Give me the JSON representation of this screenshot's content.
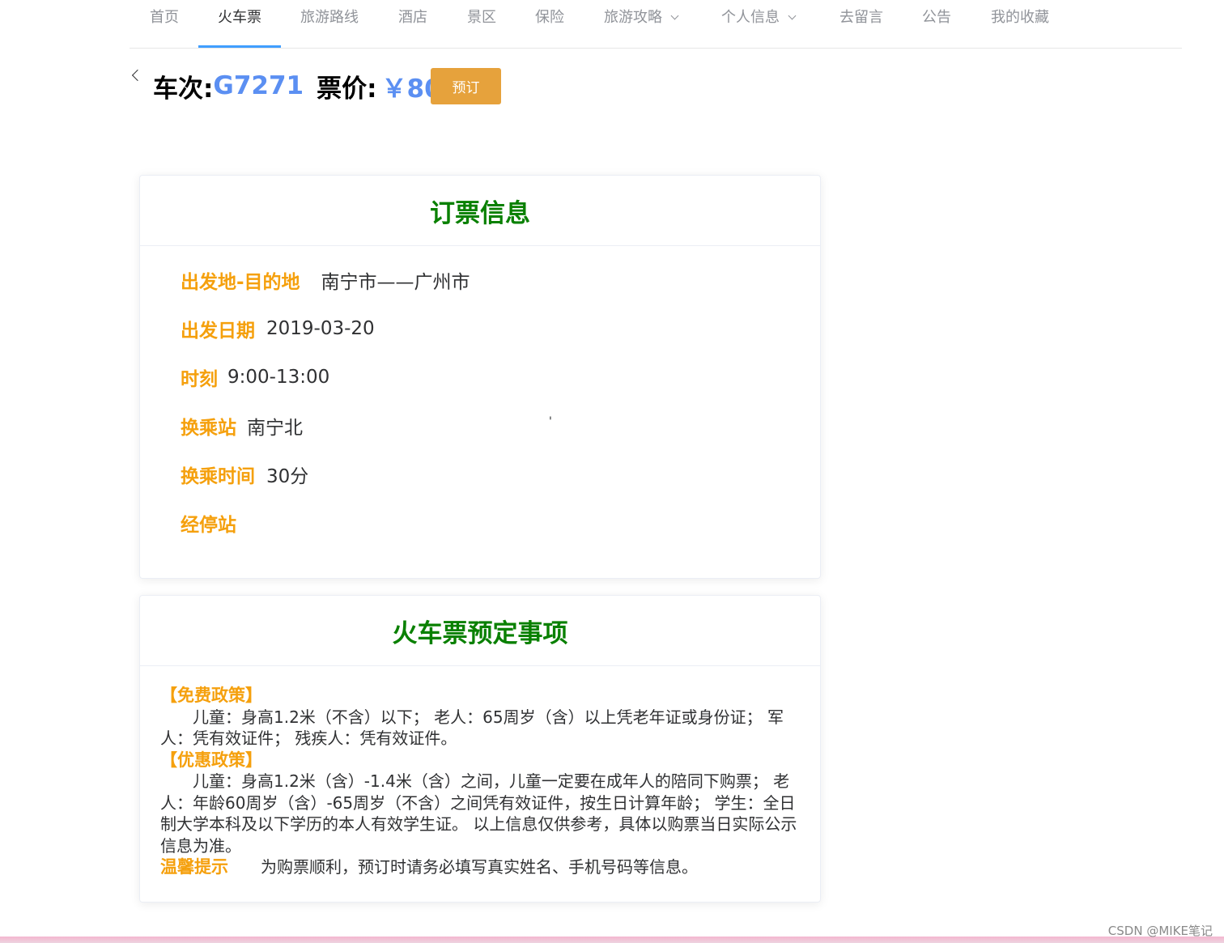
{
  "nav": {
    "items": [
      {
        "label": "首页"
      },
      {
        "label": "火车票"
      },
      {
        "label": "旅游路线"
      },
      {
        "label": "酒店"
      },
      {
        "label": "景区"
      },
      {
        "label": "保险"
      },
      {
        "label": "旅游攻略"
      },
      {
        "label": "个人信息"
      },
      {
        "label": "去留言"
      },
      {
        "label": "公告"
      },
      {
        "label": "我的收藏"
      }
    ],
    "active": "火车票",
    "accent_color": "#409EFF"
  },
  "header": {
    "train_label": "车次:",
    "train_no": "G7271",
    "price_label": "票价:",
    "price": "￥80",
    "book_button": "预订",
    "book_button_color": "#e6a23c",
    "value_color": "#5b8ff2"
  },
  "booking_info": {
    "title": "订票信息",
    "title_color": "#098000",
    "label_color": "#f5a00d",
    "rows": [
      {
        "label": "出发地-目的地",
        "value": "南宁市——广州市"
      },
      {
        "label": "出发日期",
        "value": "2019-03-20"
      },
      {
        "label": "时刻",
        "value": "9:00-13:00"
      },
      {
        "label": "换乘站",
        "value": "南宁北"
      },
      {
        "label": "换乘时间",
        "value": "30分"
      },
      {
        "label": "经停站",
        "value": ""
      }
    ],
    "stray_mark": "'"
  },
  "notice": {
    "title": "火车票预定事项",
    "free_title": "【免费政策】",
    "free_text": "儿童：身高1.2米（不含）以下； 老人：65周岁（含）以上凭老年证或身份证； 军人：凭有效证件； 残疾人：凭有效证件。",
    "discount_title": "【优惠政策】",
    "discount_text": "儿童：身高1.2米（含）-1.4米（含）之间，儿童一定要在成年人的陪同下购票； 老人：年龄60周岁（含）-65周岁（不含）之间凭有效证件，按生日计算年龄； 学生：全日制大学本科及以下学历的本人有效学生证。 以上信息仅供参考，具体以购票当日实际公示信息为准。",
    "tip_label": "温馨提示",
    "tip_text": "为购票顺利，预订时请务必填写真实姓名、手机号码等信息。"
  },
  "footer": {
    "watermark": "CSDN @MIKE笔记"
  }
}
